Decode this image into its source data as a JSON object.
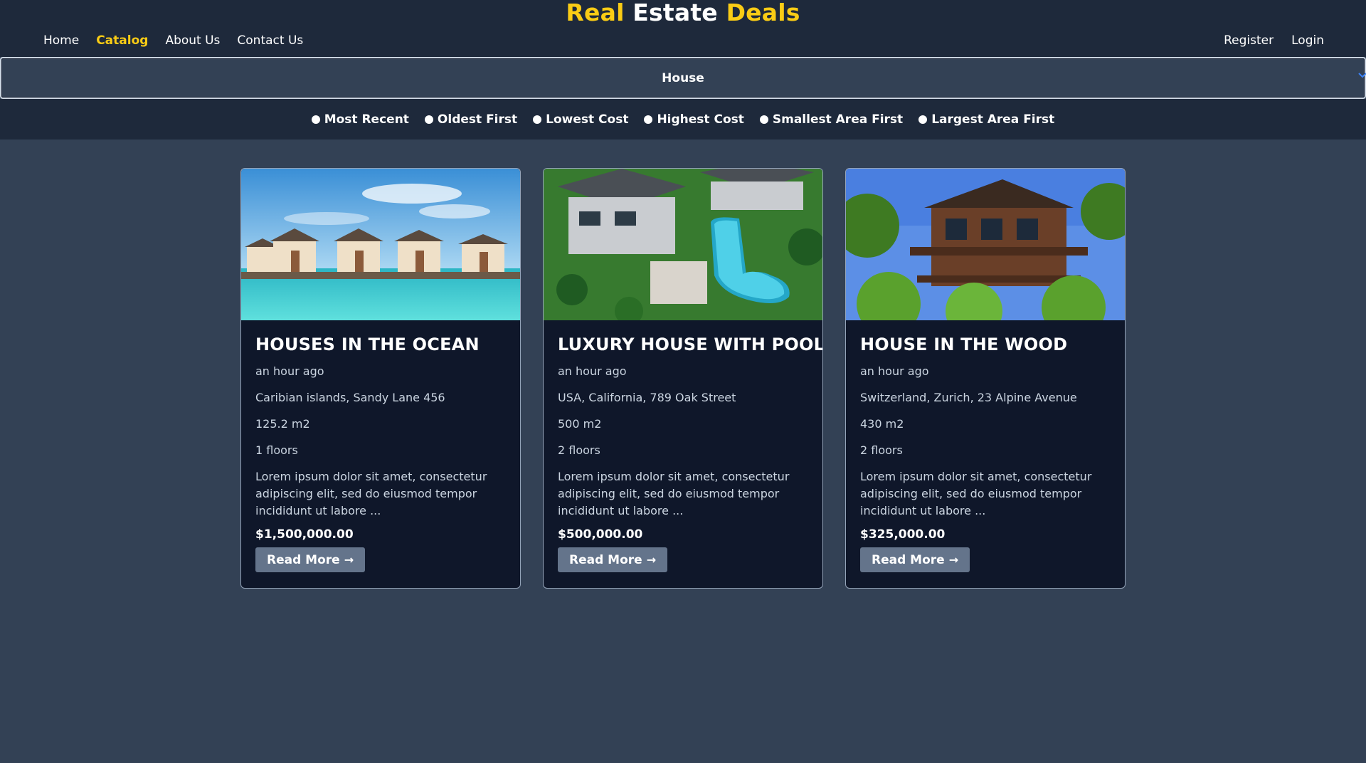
{
  "brand": {
    "part1": "Real",
    "part2": "Estate",
    "part3": "Deals"
  },
  "nav": {
    "left": [
      {
        "label": "Home"
      },
      {
        "label": "Catalog"
      },
      {
        "label": "About Us"
      },
      {
        "label": "Contact Us"
      }
    ],
    "right": [
      {
        "label": "Register"
      },
      {
        "label": "Login"
      }
    ],
    "active": "Catalog"
  },
  "category_select": {
    "value": "House"
  },
  "sort_options": [
    {
      "label": "Most Recent"
    },
    {
      "label": "Oldest First"
    },
    {
      "label": "Lowest Cost"
    },
    {
      "label": "Highest Cost"
    },
    {
      "label": "Smallest Area First"
    },
    {
      "label": "Largest Area First"
    }
  ],
  "listings": [
    {
      "title": "HOUSES IN THE OCEAN",
      "posted": "an hour ago",
      "location": "Caribian islands, Sandy Lane 456",
      "area": "125.2 m2",
      "floors": "1 floors",
      "description": "Lorem ipsum dolor sit amet, consectetur adipiscing elit, sed do eiusmod tempor incididunt ut labore ...",
      "price": "$1,500,000.00",
      "button": "Read More",
      "image": "overwater-bungalows-photo"
    },
    {
      "title": "LUXURY HOUSE WITH POOL",
      "posted": "an hour ago",
      "location": "USA, California, 789 Oak Street",
      "area": "500 m2",
      "floors": "2 floors",
      "description": "Lorem ipsum dolor sit amet, consectetur adipiscing elit, sed do eiusmod tempor incididunt ut labore ...",
      "price": "$500,000.00",
      "button": "Read More",
      "image": "aerial-pool-villa-photo"
    },
    {
      "title": "HOUSE IN THE WOOD",
      "posted": "an hour ago",
      "location": "Switzerland, Zurich, 23 Alpine Avenue",
      "area": "430 m2",
      "floors": "2 floors",
      "description": "Lorem ipsum dolor sit amet, consectetur adipiscing elit, sed do eiusmod tempor incididunt ut labore ...",
      "price": "$325,000.00",
      "button": "Read More",
      "image": "forest-wooden-house-photo"
    }
  ],
  "colors": {
    "accent": "#facc15",
    "header_bg": "#1e293b",
    "page_bg": "#334155",
    "card_bg": "#0f172a",
    "button_bg": "#64748b"
  }
}
